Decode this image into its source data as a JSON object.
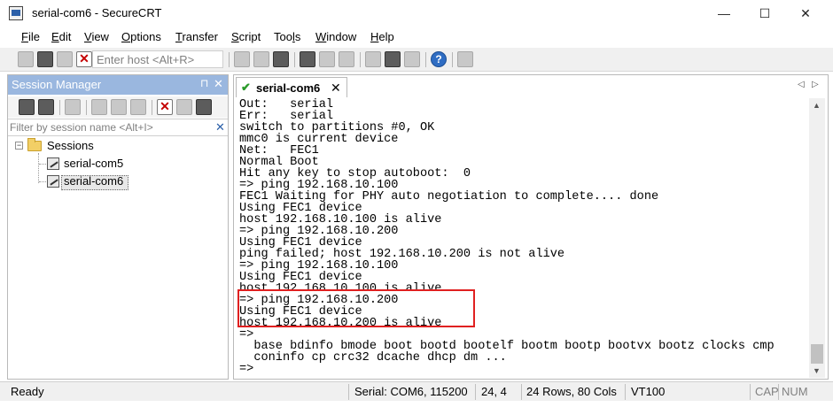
{
  "window": {
    "title": "serial-com6 - SecureCRT",
    "minimize_glyph": "—",
    "maximize_glyph": "☐",
    "close_glyph": "✕"
  },
  "menu": [
    {
      "key": "F",
      "rest": "ile"
    },
    {
      "key": "E",
      "rest": "dit"
    },
    {
      "key": "V",
      "rest": "iew"
    },
    {
      "key": "O",
      "rest": "ptions"
    },
    {
      "key": "T",
      "rest": "ransfer"
    },
    {
      "key": "S",
      "rest": "cript"
    },
    {
      "pre": "Too",
      "key": "l",
      "rest": "s"
    },
    {
      "key": "W",
      "rest": "indow"
    },
    {
      "key": "H",
      "rest": "elp"
    }
  ],
  "toolbar": {
    "host_placeholder": "Enter host <Alt+R>",
    "help_glyph": "?",
    "disconnect_glyph": "✕"
  },
  "session_manager": {
    "title": "Session Manager",
    "pin_glyph": "⊓",
    "close_glyph": "✕",
    "filter_placeholder": "Filter by session name <Alt+I>",
    "filter_clear_glyph": "✕",
    "tree": {
      "expander": "−",
      "root": "Sessions",
      "items": [
        "serial-com5",
        "serial-com6"
      ],
      "selected": "serial-com6"
    }
  },
  "terminal": {
    "tab_label": "serial-com6",
    "tab_check": "✔",
    "tab_close": "✕",
    "nav_left": "◁",
    "nav_right": "▷",
    "lines": [
      "Out:   serial",
      "Err:   serial",
      "switch to partitions #0, OK",
      "mmc0 is current device",
      "Net:   FEC1",
      "Normal Boot",
      "Hit any key to stop autoboot:  0",
      "=> ping 192.168.10.100",
      "FEC1 Waiting for PHY auto negotiation to complete.... done",
      "Using FEC1 device",
      "host 192.168.10.100 is alive",
      "=> ping 192.168.10.200",
      "Using FEC1 device",
      "ping failed; host 192.168.10.200 is not alive",
      "=> ping 192.168.10.100",
      "Using FEC1 device",
      "host 192.168.10.100 is alive",
      "=> ping 192.168.10.200",
      "Using FEC1 device",
      "host 192.168.10.200 is alive",
      "=>",
      "  base bdinfo bmode boot bootd bootelf bootm bootp bootvx bootz clocks cmp",
      "  coninfo cp crc32 dcache dhcp dm ...",
      "",
      "=>"
    ],
    "highlight_color": "#e02020"
  },
  "status": {
    "ready": "Ready",
    "serial": "Serial: COM6, 115200",
    "cursor": "24,  4",
    "size": "24 Rows, 80 Cols",
    "emulation": "VT100",
    "caps": "CAP",
    "num": "NUM"
  }
}
